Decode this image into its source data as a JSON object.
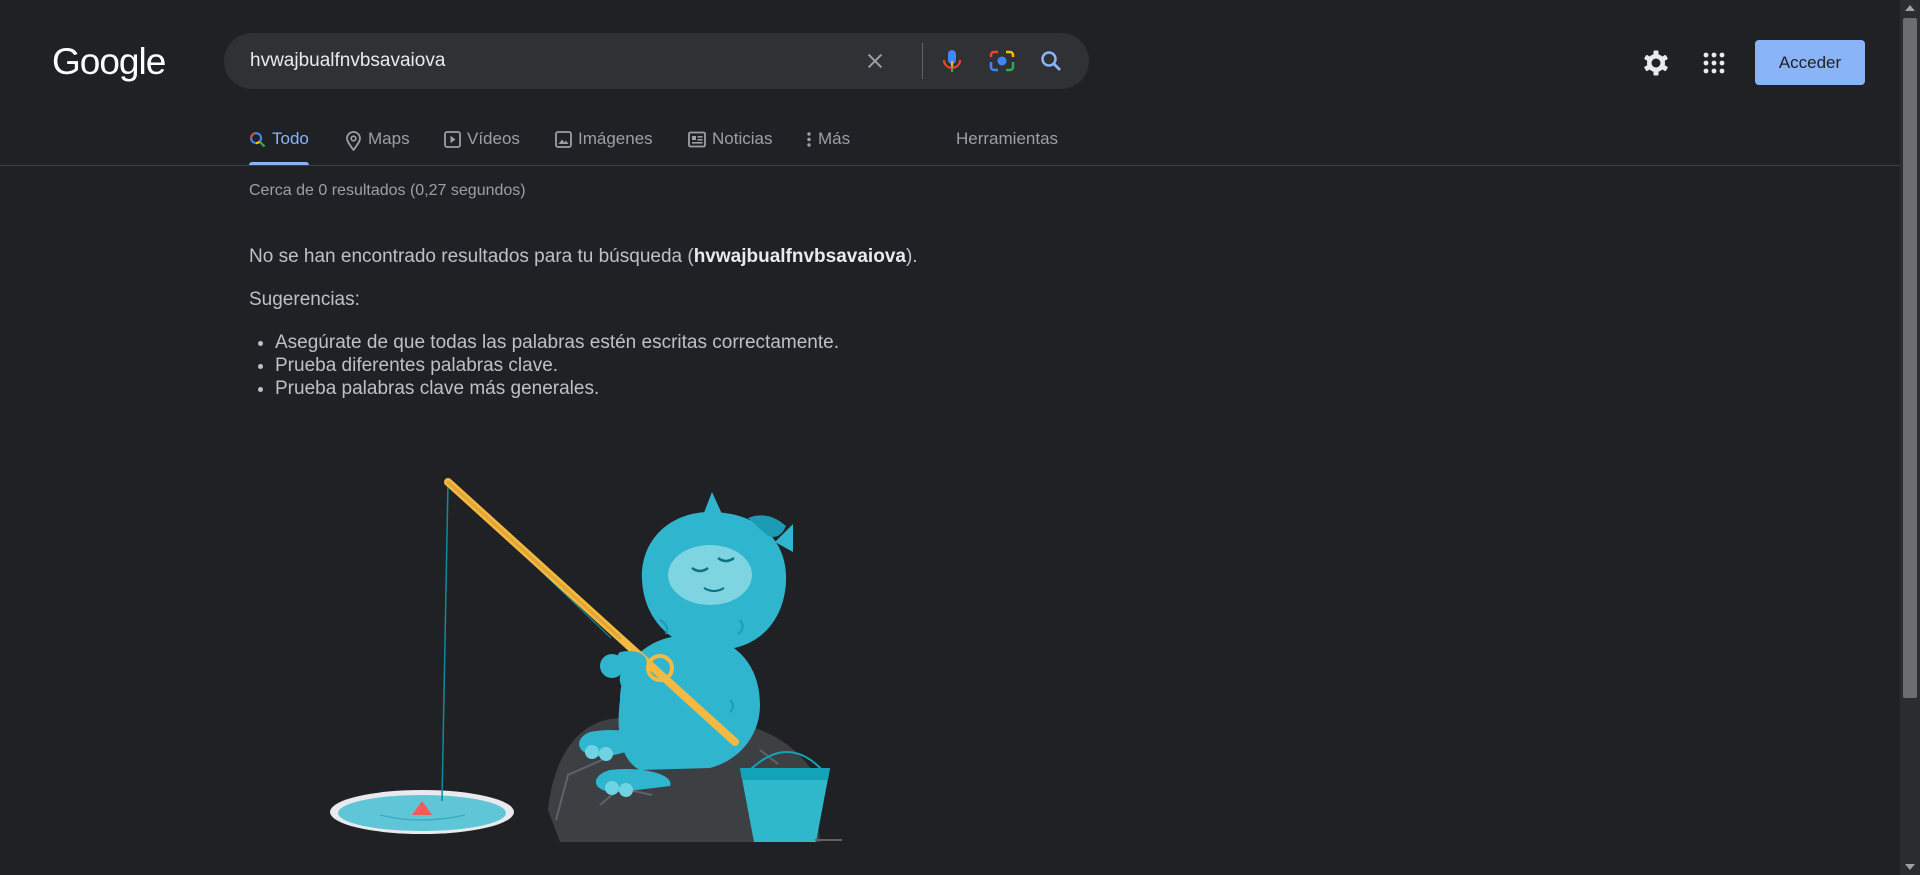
{
  "header": {
    "logo_text": "Google",
    "search_value": "hvwajbualfnvbsavaiova",
    "signin_label": "Acceder"
  },
  "tabs": [
    {
      "label": "Todo",
      "icon": "search-icon",
      "active": true
    },
    {
      "label": "Maps",
      "icon": "map-pin-icon"
    },
    {
      "label": "Vídeos",
      "icon": "play-icon"
    },
    {
      "label": "Imágenes",
      "icon": "image-icon"
    },
    {
      "label": "Noticias",
      "icon": "news-icon"
    },
    {
      "label": "Más",
      "icon": "more-vert-icon"
    },
    {
      "label": "Herramientas"
    }
  ],
  "results": {
    "stats": "Cerca de 0 resultados (0,27 segundos)",
    "no_results_prefix": "No se han encontrado resultados para tu búsqueda (",
    "no_results_query": "hvwajbualfnvbsavaiova",
    "no_results_suffix": ").",
    "suggestions_title": "Sugerencias:",
    "suggestions": [
      "Asegúrate de que todas las palabras estén escritas correctamente.",
      "Prueba diferentes palabras clave.",
      "Prueba palabras clave más generales."
    ]
  },
  "colors": {
    "background": "#202124",
    "accent": "#8ab4f8",
    "yeti": "#30b5cf"
  }
}
